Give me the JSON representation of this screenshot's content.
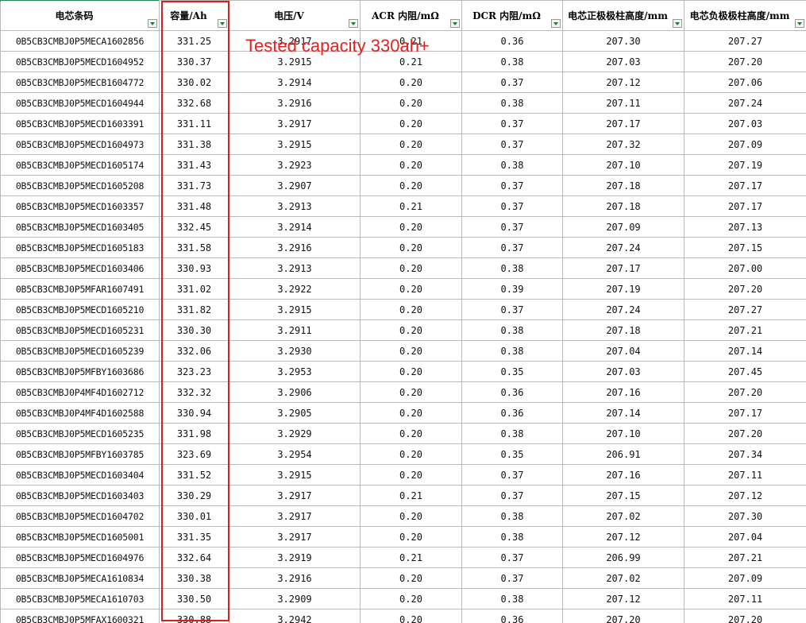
{
  "headers": [
    {
      "label": "电芯条码"
    },
    {
      "label": "容量/Ah"
    },
    {
      "label": "电压/V"
    },
    {
      "label": "ACR 内阻/mΩ"
    },
    {
      "label": "DCR 内阻/mΩ"
    },
    {
      "label": "电芯正极极柱高度/mm"
    },
    {
      "label": "电芯负极极柱高度/mm"
    }
  ],
  "annotation": "Tested capacity 330ah+",
  "colors": {
    "highlight_box": "#d42020",
    "annotation_text": "#e8201e"
  },
  "rows": [
    [
      "0B5CB3CMBJ0P5MECA1602856",
      "331.25",
      "3.2917",
      "0.21",
      "0.36",
      "207.30",
      "207.27"
    ],
    [
      "0B5CB3CMBJ0P5MECD1604952",
      "330.37",
      "3.2915",
      "0.21",
      "0.38",
      "207.03",
      "207.20"
    ],
    [
      "0B5CB3CMBJ0P5MECB1604772",
      "330.02",
      "3.2914",
      "0.20",
      "0.37",
      "207.12",
      "207.06"
    ],
    [
      "0B5CB3CMBJ0P5MECD1604944",
      "332.68",
      "3.2916",
      "0.20",
      "0.38",
      "207.11",
      "207.24"
    ],
    [
      "0B5CB3CMBJ0P5MECD1603391",
      "331.11",
      "3.2917",
      "0.20",
      "0.37",
      "207.17",
      "207.03"
    ],
    [
      "0B5CB3CMBJ0P5MECD1604973",
      "331.38",
      "3.2915",
      "0.20",
      "0.37",
      "207.32",
      "207.09"
    ],
    [
      "0B5CB3CMBJ0P5MECD1605174",
      "331.43",
      "3.2923",
      "0.20",
      "0.38",
      "207.10",
      "207.19"
    ],
    [
      "0B5CB3CMBJ0P5MECD1605208",
      "331.73",
      "3.2907",
      "0.20",
      "0.37",
      "207.18",
      "207.17"
    ],
    [
      "0B5CB3CMBJ0P5MECD1603357",
      "331.48",
      "3.2913",
      "0.21",
      "0.37",
      "207.18",
      "207.17"
    ],
    [
      "0B5CB3CMBJ0P5MECD1603405",
      "332.45",
      "3.2914",
      "0.20",
      "0.37",
      "207.09",
      "207.13"
    ],
    [
      "0B5CB3CMBJ0P5MECD1605183",
      "331.58",
      "3.2916",
      "0.20",
      "0.37",
      "207.24",
      "207.15"
    ],
    [
      "0B5CB3CMBJ0P5MECD1603406",
      "330.93",
      "3.2913",
      "0.20",
      "0.38",
      "207.17",
      "207.00"
    ],
    [
      "0B5CB3CMBJ0P5MFAR1607491",
      "331.02",
      "3.2922",
      "0.20",
      "0.39",
      "207.19",
      "207.20"
    ],
    [
      "0B5CB3CMBJ0P5MECD1605210",
      "331.82",
      "3.2915",
      "0.20",
      "0.37",
      "207.24",
      "207.27"
    ],
    [
      "0B5CB3CMBJ0P5MECD1605231",
      "330.30",
      "3.2911",
      "0.20",
      "0.38",
      "207.18",
      "207.21"
    ],
    [
      "0B5CB3CMBJ0P5MECD1605239",
      "332.06",
      "3.2930",
      "0.20",
      "0.38",
      "207.04",
      "207.14"
    ],
    [
      "0B5CB3CMBJ0P5MFBY1603686",
      "323.23",
      "3.2953",
      "0.20",
      "0.35",
      "207.03",
      "207.45"
    ],
    [
      "0B5CB3CMBJ0P4MF4D1602712",
      "332.32",
      "3.2906",
      "0.20",
      "0.36",
      "207.16",
      "207.20"
    ],
    [
      "0B5CB3CMBJ0P4MF4D1602588",
      "330.94",
      "3.2905",
      "0.20",
      "0.36",
      "207.14",
      "207.17"
    ],
    [
      "0B5CB3CMBJ0P5MECD1605235",
      "331.98",
      "3.2929",
      "0.20",
      "0.38",
      "207.10",
      "207.20"
    ],
    [
      "0B5CB3CMBJ0P5MFBY1603785",
      "323.69",
      "3.2954",
      "0.20",
      "0.35",
      "206.91",
      "207.34"
    ],
    [
      "0B5CB3CMBJ0P5MECD1603404",
      "331.52",
      "3.2915",
      "0.20",
      "0.37",
      "207.16",
      "207.11"
    ],
    [
      "0B5CB3CMBJ0P5MECD1603403",
      "330.29",
      "3.2917",
      "0.21",
      "0.37",
      "207.15",
      "207.12"
    ],
    [
      "0B5CB3CMBJ0P5MECD1604702",
      "330.01",
      "3.2917",
      "0.20",
      "0.38",
      "207.02",
      "207.30"
    ],
    [
      "0B5CB3CMBJ0P5MECD1605001",
      "331.35",
      "3.2917",
      "0.20",
      "0.38",
      "207.12",
      "207.04"
    ],
    [
      "0B5CB3CMBJ0P5MECD1604976",
      "332.64",
      "3.2919",
      "0.21",
      "0.37",
      "206.99",
      "207.21"
    ],
    [
      "0B5CB3CMBJ0P5MECA1610834",
      "330.38",
      "3.2916",
      "0.20",
      "0.37",
      "207.02",
      "207.09"
    ],
    [
      "0B5CB3CMBJ0P5MECA1610703",
      "330.50",
      "3.2909",
      "0.20",
      "0.38",
      "207.12",
      "207.11"
    ],
    [
      "0B5CB3CMBJ0P5MFAX1600321",
      "330.88",
      "3.2942",
      "0.20",
      "0.36",
      "207.20",
      "207.20"
    ]
  ]
}
